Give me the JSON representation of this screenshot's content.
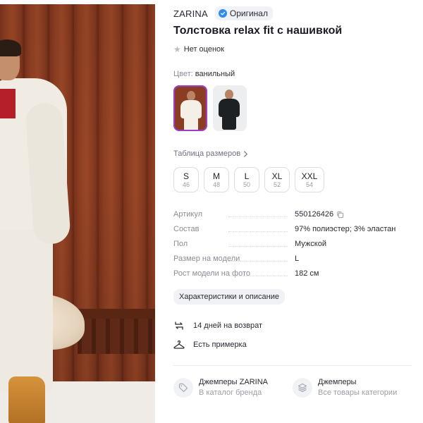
{
  "product": {
    "brand": "ZARINA",
    "original_badge": "Оригинал",
    "title": "Толстовка relax fit с нашивкой",
    "rating_text": "Нет оценок",
    "color_label": "Цвет:",
    "color_value": "ванильный"
  },
  "size_table": {
    "label": "Таблица размеров"
  },
  "sizes": [
    {
      "name": "S",
      "num": "46"
    },
    {
      "name": "M",
      "num": "48"
    },
    {
      "name": "L",
      "num": "50"
    },
    {
      "name": "XL",
      "num": "52"
    },
    {
      "name": "XXL",
      "num": "54"
    }
  ],
  "specs": [
    {
      "key": "Артикул",
      "value": "550126426"
    },
    {
      "key": "Состав",
      "value": "97% полиэстер; 3% эластан"
    },
    {
      "key": "Пол",
      "value": "Мужской"
    },
    {
      "key": "Размер на модели",
      "value": "L"
    },
    {
      "key": "Рост модели на фото",
      "value": "182 см"
    }
  ],
  "characteristics_button": "Характеристики и описание",
  "features": {
    "return": "14 дней на возврат",
    "fitting": "Есть примерка"
  },
  "bottom_links": [
    {
      "title": "Джемперы ZARINA",
      "subtitle": "В каталог бренда",
      "icon": "tag-icon"
    },
    {
      "title": "Джемперы",
      "subtitle": "Все товары категории",
      "icon": "stack-icon"
    }
  ],
  "colors": {
    "accent_selected": "#9b3dc7",
    "verified_blue": "#2f8cf2"
  }
}
